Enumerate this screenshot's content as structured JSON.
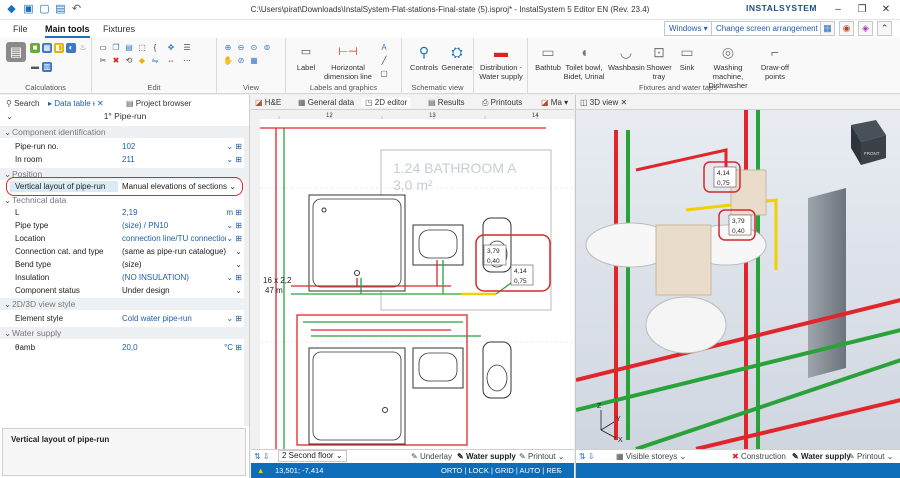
{
  "window": {
    "title": "C:\\Users\\pirat\\Downloads\\InstalSystem-Flat-stations-Final-state (5).isproj* - InstalSystem 5 Editor EN (Rev. 23.4)",
    "brand": "INSTALSYSTEM"
  },
  "menu": {
    "tabs": [
      "File",
      "Main tools",
      "Fixtures"
    ],
    "windows_button": "Windows",
    "arrangement_button": "Change screen arrangement"
  },
  "ribbon": {
    "groups": {
      "calculations": "Calculations",
      "edit": "Edit",
      "view": "View",
      "labels_graphics": "Labels and graphics",
      "schematic_view": "Schematic view",
      "fixtures_taps": "Fixtures and water taps"
    },
    "buttons": {
      "label": "Label",
      "horizontal_dimension": "Horizontal dimension line",
      "controls": "Controls",
      "generate": "Generate",
      "distribution": "Distribution - Water supply",
      "bathtub": "Bathtub",
      "toilet": "Toilet bowl, Bidet, Urinal",
      "washbasin": "Washbasin",
      "shower_tray": "Shower tray",
      "sink": "Sink",
      "washing_machine": "Washing machine, Dishwasher",
      "draw_off": "Draw-off points"
    }
  },
  "left_panel": {
    "tabs": {
      "search": "Search",
      "data_table": "Data table",
      "project_browser": "Project browser"
    },
    "pin": "ᵻ",
    "header_title": "1° Pipe-run",
    "sections": {
      "component_identification": "Component identification",
      "position": "Position",
      "technical_data": "Technical data",
      "view_style": "2D/3D view style",
      "water_supply": "Water supply"
    },
    "rows": {
      "pipe_run_no": {
        "label": "Pipe-run no.",
        "value": "102"
      },
      "in_room": {
        "label": "In room",
        "value": "211"
      },
      "vertical_layout": {
        "label": "Vertical layout of pipe-run",
        "value": "Manual elevations of sections"
      },
      "length": {
        "label": "L",
        "value": "2,19",
        "unit": "m"
      },
      "pipe_type": {
        "label": "Pipe type",
        "value": "(size) / PN10"
      },
      "location": {
        "label": "Location",
        "value": "connection line/TU connection"
      },
      "connection_cat": {
        "label": "Connection cat. and type",
        "value": "(same as pipe-run catalogue)"
      },
      "bend_type": {
        "label": "Bend type",
        "value": "(size)"
      },
      "insulation": {
        "label": "Insulation",
        "value": "(NO INSULATION)"
      },
      "component_status": {
        "label": "Component status",
        "value": "Under design"
      },
      "element_style": {
        "label": "Element style",
        "value": "Cold water pipe-run"
      },
      "theta_amb": {
        "label": "θamb",
        "value": "20,0",
        "unit": "°C"
      }
    },
    "description_title": "Vertical layout of pipe-run"
  },
  "editor": {
    "tabs": {
      "hae": "H&E",
      "general_data": "General data",
      "editor_2d": "2D editor",
      "results": "Results",
      "printouts": "Printouts",
      "ma": "Ma"
    },
    "ruler": [
      "12",
      "13",
      "14"
    ],
    "room_name": "1.24 BATHROOM A",
    "room_area": "3,0 m²",
    "pipe_label_1": "16 x 2,2",
    "pipe_label_2": "47 m",
    "elev_a": "3,79",
    "elev_b": "0,40",
    "elev_c": "4,14",
    "elev_d": "0,75",
    "floor": "2 Second floor",
    "bottom_links": {
      "underlay": "Underlay",
      "water_supply": "Water supply",
      "printout": "Printout"
    },
    "coords": "13,501; -7,414",
    "status_flags": "ORTO | LOCK | GRID | AUTO | REF"
  },
  "view3d": {
    "tab": "3D view",
    "cube_label": "FRONT",
    "elev_1_top": "4,14",
    "elev_1_bottom": "0,75",
    "elev_2_top": "3,79",
    "elev_2_bottom": "0,40",
    "visible_storeys": "Visible storeys",
    "bottom_links": {
      "construction": "Construction",
      "water_supply": "Water supply",
      "printout": "Printout"
    },
    "axes": {
      "x": "X",
      "y": "Y",
      "z": "Z"
    }
  },
  "colors": {
    "accent": "#1f6fb8",
    "red_pipe": "#e0262a",
    "green_pipe": "#2aa23a",
    "yellow_pipe": "#f0d000",
    "highlight": "#dbeaf7"
  }
}
